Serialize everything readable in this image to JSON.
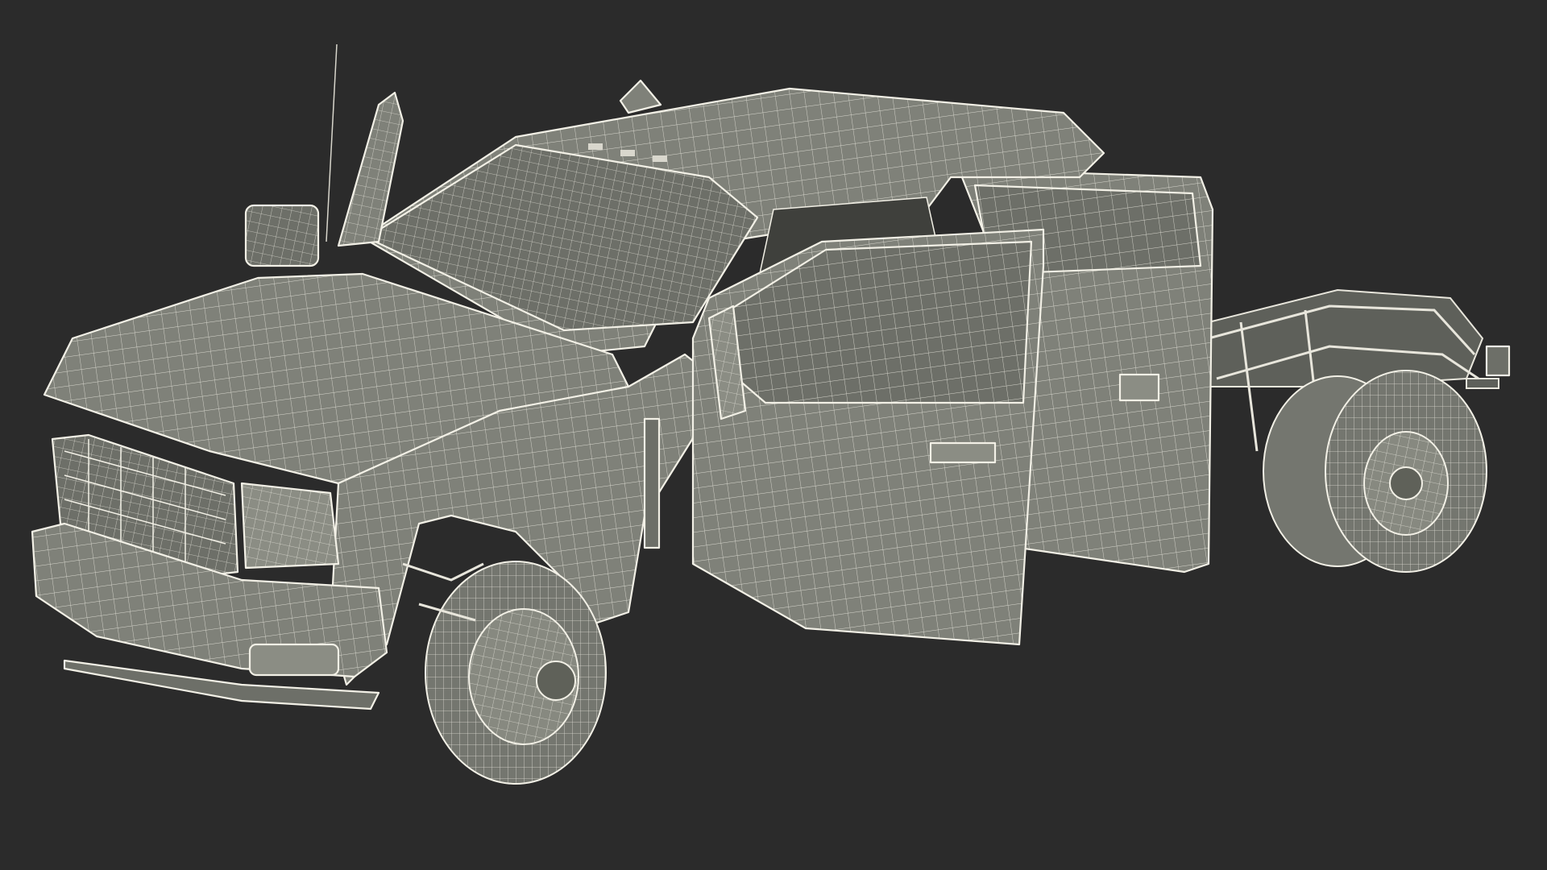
{
  "scene": {
    "subject": "",
    "colors": {
      "background": "#2b2b2b",
      "surface": "#7f8179",
      "wire": "#f2f0e6"
    }
  }
}
